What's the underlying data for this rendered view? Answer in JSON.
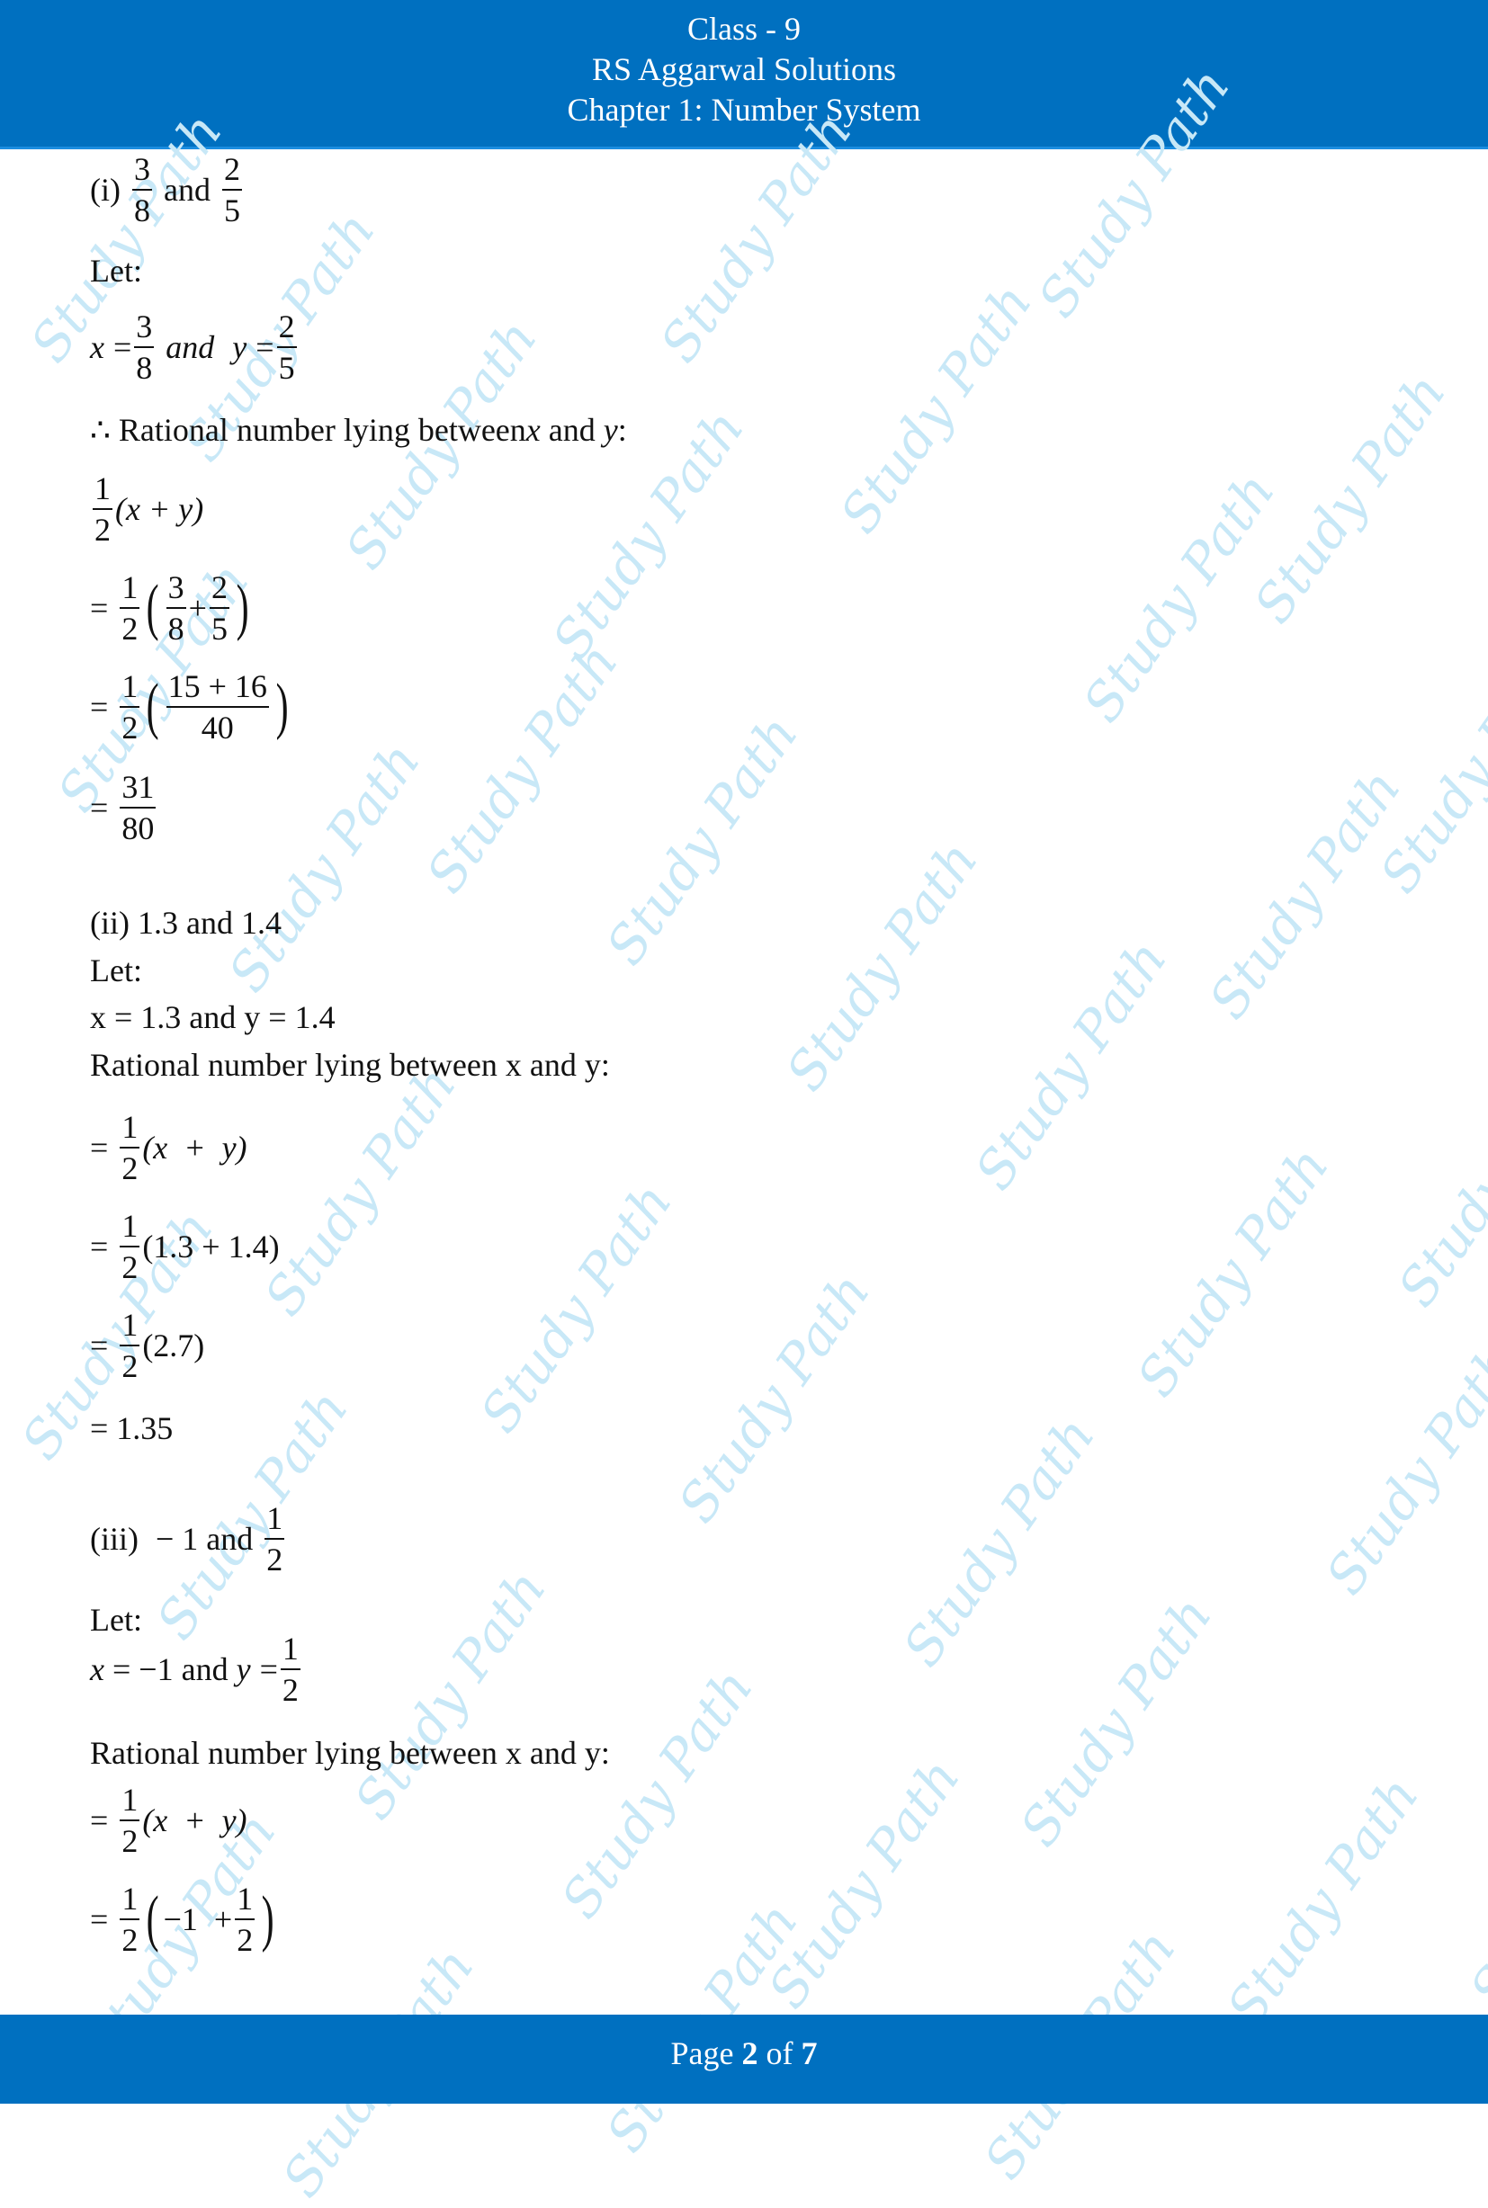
{
  "header": {
    "line1": "Class - 9",
    "line2": "RS Aggarwal Solutions",
    "line3": "Chapter 1: Number System"
  },
  "footer": {
    "prefix": "Page ",
    "current": "2",
    "middle": " of ",
    "total": "7"
  },
  "watermark_text": "Study Path",
  "colors": {
    "brand_blue": "#0070c0",
    "watermark": "#c8e8f7"
  },
  "part_i": {
    "label": "(i)",
    "and": "and",
    "a": {
      "num": "3",
      "den": "8"
    },
    "b": {
      "num": "2",
      "den": "5"
    },
    "let": "Let:",
    "x": "x",
    "eq": "=",
    "and_italic": "and",
    "y": "y",
    "therefore": "∴ Rational number lying between ",
    "between_x": "x",
    "between_and": " and ",
    "between_y": "y",
    "colon": ":",
    "half": {
      "num": "1",
      "den": "2"
    },
    "xy": "(x + y)",
    "plus": "+",
    "sum_num": "15 + 16",
    "sum_den": "40",
    "result": {
      "num": "31",
      "den": "80"
    }
  },
  "part_ii": {
    "heading": "(ii) 1.3 and 1.4",
    "let": "Let:",
    "assign": "x = 1.3 and y = 1.4",
    "statement": "Rational number lying between x and y:",
    "half": {
      "num": "1",
      "den": "2"
    },
    "step1": "(x  +  y)",
    "step2": "(1.3 + 1.4)",
    "step3": "(2.7)",
    "result": "= 1.35"
  },
  "part_iii": {
    "label": "(iii)",
    "minus_one": " − 1 and",
    "b": {
      "num": "1",
      "den": "2"
    },
    "let": "Let:",
    "assign_x": "x",
    "assign_mid": " = −1 and ",
    "assign_y": "y",
    "statement": "Rational number lying between x and y:",
    "half": {
      "num": "1",
      "den": "2"
    },
    "step1": "(x  +  y)",
    "step2_inner": "−1  +"
  },
  "eq_sign": "="
}
